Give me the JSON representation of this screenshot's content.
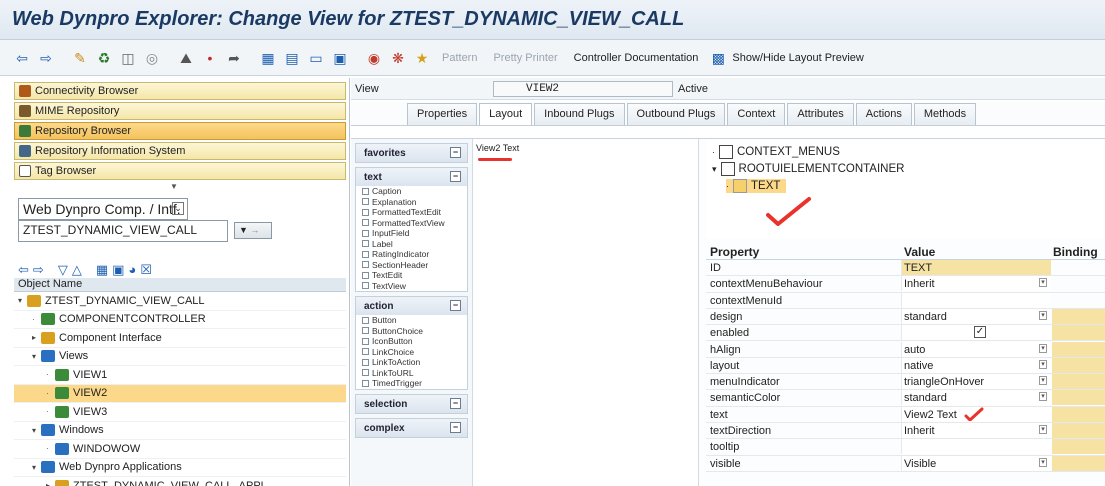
{
  "window": {
    "title": "Web Dynpro Explorer: Change View for ZTEST_DYNAMIC_VIEW_CALL"
  },
  "toolbar": {
    "pattern": "Pattern",
    "pretty_printer": "Pretty Printer",
    "controller_doc": "Controller Documentation",
    "layout_preview": "Show/Hide Layout Preview"
  },
  "nav": {
    "buttons": [
      "Connectivity Browser",
      "MIME Repository",
      "Repository Browser",
      "Repository Information System",
      "Tag Browser"
    ],
    "object_type": "Web Dynpro Comp. / Intf.",
    "object_name": "ZTEST_DYNAMIC_VIEW_CALL",
    "object_header": "Object Name",
    "tree": [
      {
        "label": "ZTEST_DYNAMIC_VIEW_CALL",
        "indent": 0
      },
      {
        "label": "COMPONENTCONTROLLER",
        "indent": 1
      },
      {
        "label": "Component Interface",
        "indent": 1
      },
      {
        "label": "Views",
        "indent": 1
      },
      {
        "label": "VIEW1",
        "indent": 2
      },
      {
        "label": "VIEW2",
        "indent": 2
      },
      {
        "label": "VIEW3",
        "indent": 2
      },
      {
        "label": "Windows",
        "indent": 1
      },
      {
        "label": "WINDOWOW",
        "indent": 2
      },
      {
        "label": "Web Dynpro Applications",
        "indent": 1
      },
      {
        "label": "ZTEST_DYNAMIC_VIEW_CALL_APPL",
        "indent": 2
      }
    ]
  },
  "view": {
    "label": "View",
    "name": "VIEW2",
    "status": "Active"
  },
  "tabs": [
    "Properties",
    "Layout",
    "Inbound Plugs",
    "Outbound Plugs",
    "Context",
    "Attributes",
    "Actions",
    "Methods"
  ],
  "palette": {
    "favorites": "favorites",
    "text": {
      "title": "text",
      "items": [
        "Caption",
        "Explanation",
        "FormattedTextEdit",
        "FormattedTextView",
        "InputField",
        "Label",
        "RatingIndicator",
        "SectionHeader",
        "TextEdit",
        "TextView"
      ]
    },
    "action": {
      "title": "action",
      "items": [
        "Button",
        "ButtonChoice",
        "IconButton",
        "LinkChoice",
        "LinkToAction",
        "LinkToURL",
        "TimedTrigger"
      ]
    },
    "selection": "selection",
    "complex": "complex"
  },
  "canvas": {
    "text": "View2 Text"
  },
  "ui_tree": [
    "CONTEXT_MENUS",
    "ROOTUIELEMENTCONTAINER",
    "TEXT"
  ],
  "props": {
    "headers": [
      "Property",
      "Value",
      "Binding"
    ],
    "rows": [
      {
        "p": "ID",
        "v": "TEXT"
      },
      {
        "p": "contextMenuBehaviour",
        "v": "Inherit"
      },
      {
        "p": "contextMenuId",
        "v": ""
      },
      {
        "p": "design",
        "v": "standard"
      },
      {
        "p": "enabled",
        "v": ""
      },
      {
        "p": "hAlign",
        "v": "auto"
      },
      {
        "p": "layout",
        "v": "native"
      },
      {
        "p": "menuIndicator",
        "v": "triangleOnHover"
      },
      {
        "p": "semanticColor",
        "v": "standard"
      },
      {
        "p": "text",
        "v": "View2 Text"
      },
      {
        "p": "textDirection",
        "v": "Inherit"
      },
      {
        "p": "tooltip",
        "v": ""
      },
      {
        "p": "visible",
        "v": "Visible"
      }
    ]
  }
}
